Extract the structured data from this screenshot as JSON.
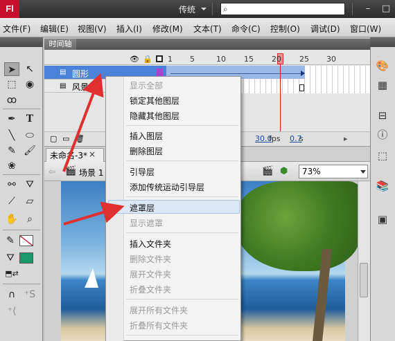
{
  "app": {
    "logo": "Fl",
    "workspace": "传统",
    "search_placeholder": ""
  },
  "window_controls": {
    "minimize": "–",
    "restore": "□"
  },
  "menu": [
    "文件(F)",
    "编辑(E)",
    "视图(V)",
    "插入(I)",
    "修改(M)",
    "文本(T)",
    "命令(C)",
    "控制(O)",
    "调试(D)",
    "窗口(W)"
  ],
  "timeline": {
    "tab": "时间轴",
    "ruler": [
      "1",
      "5",
      "10",
      "15",
      "20",
      "25",
      "30"
    ],
    "layers": [
      "圆形",
      "风景"
    ],
    "current_frame": "20",
    "fps": "30.0",
    "fps_unit": "fps",
    "time": "0.7",
    "time_unit": "s"
  },
  "document": {
    "tab": "未命名-3*",
    "close": "×",
    "scene": "场景 1",
    "zoom": "73%"
  },
  "context_menu": {
    "items": [
      {
        "label": "显示全部",
        "disabled": true
      },
      {
        "label": "锁定其他图层",
        "disabled": false
      },
      {
        "label": "隐藏其他图层",
        "disabled": false
      },
      {
        "label": "插入图层",
        "disabled": false
      },
      {
        "label": "删除图层",
        "disabled": false
      },
      {
        "label": "引导层",
        "disabled": false
      },
      {
        "label": "添加传统运动引导层",
        "disabled": false
      },
      {
        "label": "遮罩层",
        "disabled": false,
        "highlighted": true
      },
      {
        "label": "显示遮罩",
        "disabled": true
      },
      {
        "label": "插入文件夹",
        "disabled": false
      },
      {
        "label": "删除文件夹",
        "disabled": true
      },
      {
        "label": "展开文件夹",
        "disabled": true
      },
      {
        "label": "折叠文件夹",
        "disabled": true
      },
      {
        "label": "展开所有文件夹",
        "disabled": true
      },
      {
        "label": "折叠所有文件夹",
        "disabled": true
      }
    ]
  },
  "colors": {
    "accent_arrow": "#e03030",
    "layer_selected": "#4a82d8",
    "fill_color": "#1a9a6a",
    "stroke_color": "#c8102e"
  }
}
